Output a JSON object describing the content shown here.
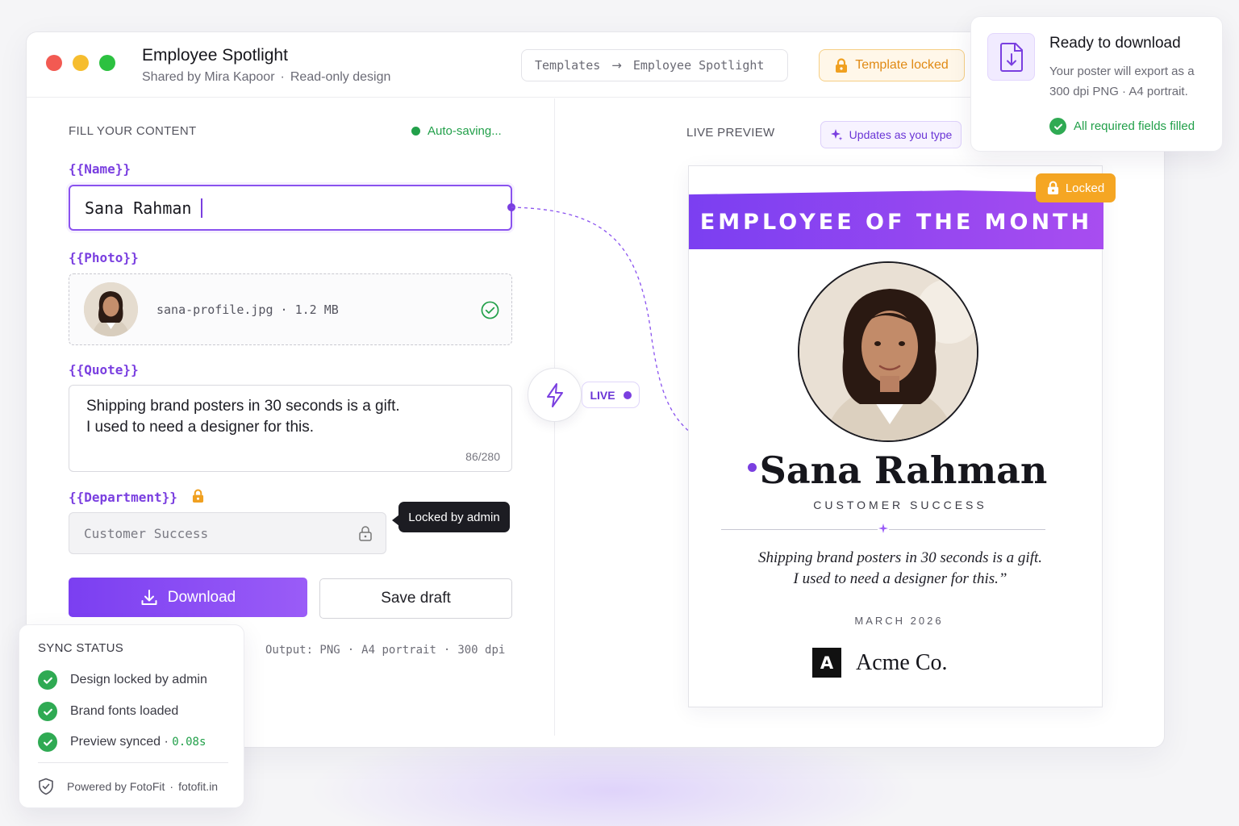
{
  "app": {
    "title": "Employee Spotlight",
    "shared_by": "Shared by Mira Kapoor",
    "mode": "Read-only design",
    "breadcrumb": [
      "Templates",
      "Employee Spotlight"
    ],
    "template_locked_label": "Template locked"
  },
  "form": {
    "section_label": "FILL YOUR CONTENT",
    "autosave_label": "Auto-saving...",
    "name_label": "{{Name}}",
    "name_value": "Sana Rahman",
    "photo_label": "{{Photo}}",
    "photo_file": "sana-profile.jpg",
    "photo_size": "1.2 MB",
    "quote_label": "{{Quote}}",
    "quote_line1": "Shipping brand posters in 30 seconds is a gift.",
    "quote_line2": "I used to need a designer for this.",
    "quote_counter": "86/280",
    "department_label": "{{Department}}",
    "department_value": "Customer Success",
    "locked_tooltip": "Locked by admin",
    "download_label": "Download",
    "save_draft_label": "Save draft",
    "output": [
      "Output: PNG",
      "A4 portrait",
      "300 dpi"
    ]
  },
  "live": {
    "pill_label": "LIVE"
  },
  "preview": {
    "section_label": "LIVE PREVIEW",
    "updates_label": "Updates as you type",
    "locked_badge": "Locked",
    "banner_title": "EMPLOYEE OF THE MONTH",
    "name": "Sana Rahman",
    "department": "CUSTOMER SUCCESS",
    "quote_line1": "Shipping brand posters in 30 seconds is a gift.",
    "quote_line2": "I used to need a designer for this.”",
    "date": "MARCH 2026",
    "brand_logo": "A",
    "brand_name": "Acme Co."
  },
  "ready_card": {
    "title": "Ready to download",
    "description": "Your poster will export as a 300 dpi PNG · A4 portrait.",
    "status": "All required fields filled"
  },
  "sync": {
    "title": "SYNC STATUS",
    "items": [
      {
        "label": "Design locked by admin"
      },
      {
        "label": "Brand fonts loaded"
      },
      {
        "label": "Preview synced",
        "detail": "0.08s"
      }
    ],
    "powered_by": "Powered by FotoFit",
    "domain": "fotofit.in"
  },
  "colors": {
    "accent": "#7b3ff1",
    "success": "#22a04a",
    "warning": "#f5a623"
  },
  "icons": [
    "lock-icon",
    "check-circle-icon",
    "download-icon",
    "sparkle-icon",
    "bolt-icon",
    "file-download-icon",
    "shield-icon",
    "arrow-right-icon"
  ]
}
